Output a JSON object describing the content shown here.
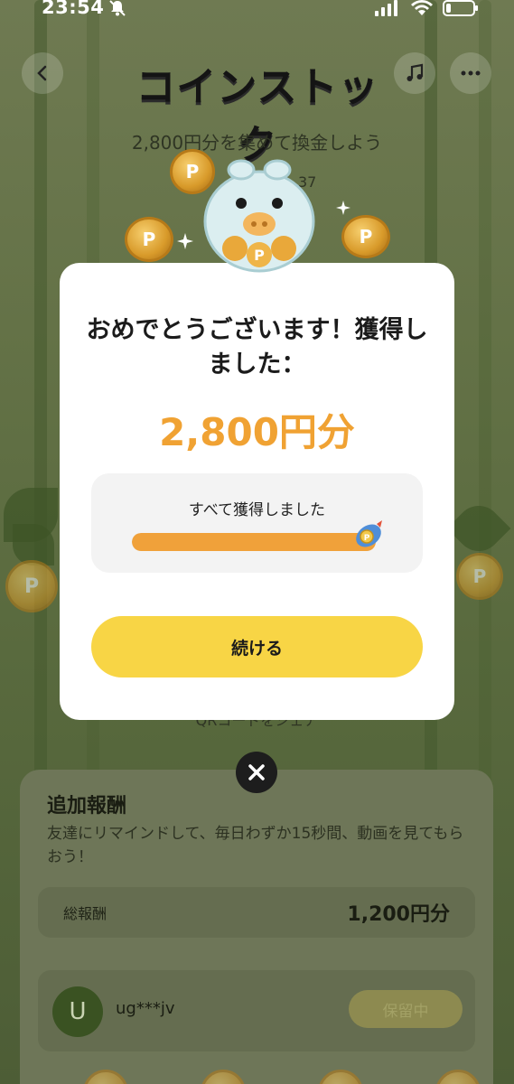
{
  "status_bar": {
    "time": "23:54"
  },
  "header": {
    "title": "コインストック",
    "subtitle": "2,800円分を集めて換金しよう",
    "count_fragment": "37"
  },
  "background": {
    "qr_text": "QRコードをシェア",
    "card": {
      "title": "追加報酬",
      "description": "友達にリマインドして、毎日わずか15秒間、動画を見てもらおう！",
      "total_label": "総報酬",
      "total_value": "1,200円分",
      "user": {
        "avatar_letter": "U",
        "name": "ug***jv",
        "status": "保留中"
      }
    }
  },
  "modal": {
    "heading": "おめでとうございます！獲得しました：",
    "amount": "2,800円分",
    "progress_label": "すべて獲得しました",
    "progress_fraction": 1.0,
    "continue_label": "続ける"
  },
  "coin_glyph": "P",
  "colors": {
    "accent_orange": "#f0a233",
    "button_yellow": "#f8d545",
    "progress_fill": "#f0a13a"
  }
}
